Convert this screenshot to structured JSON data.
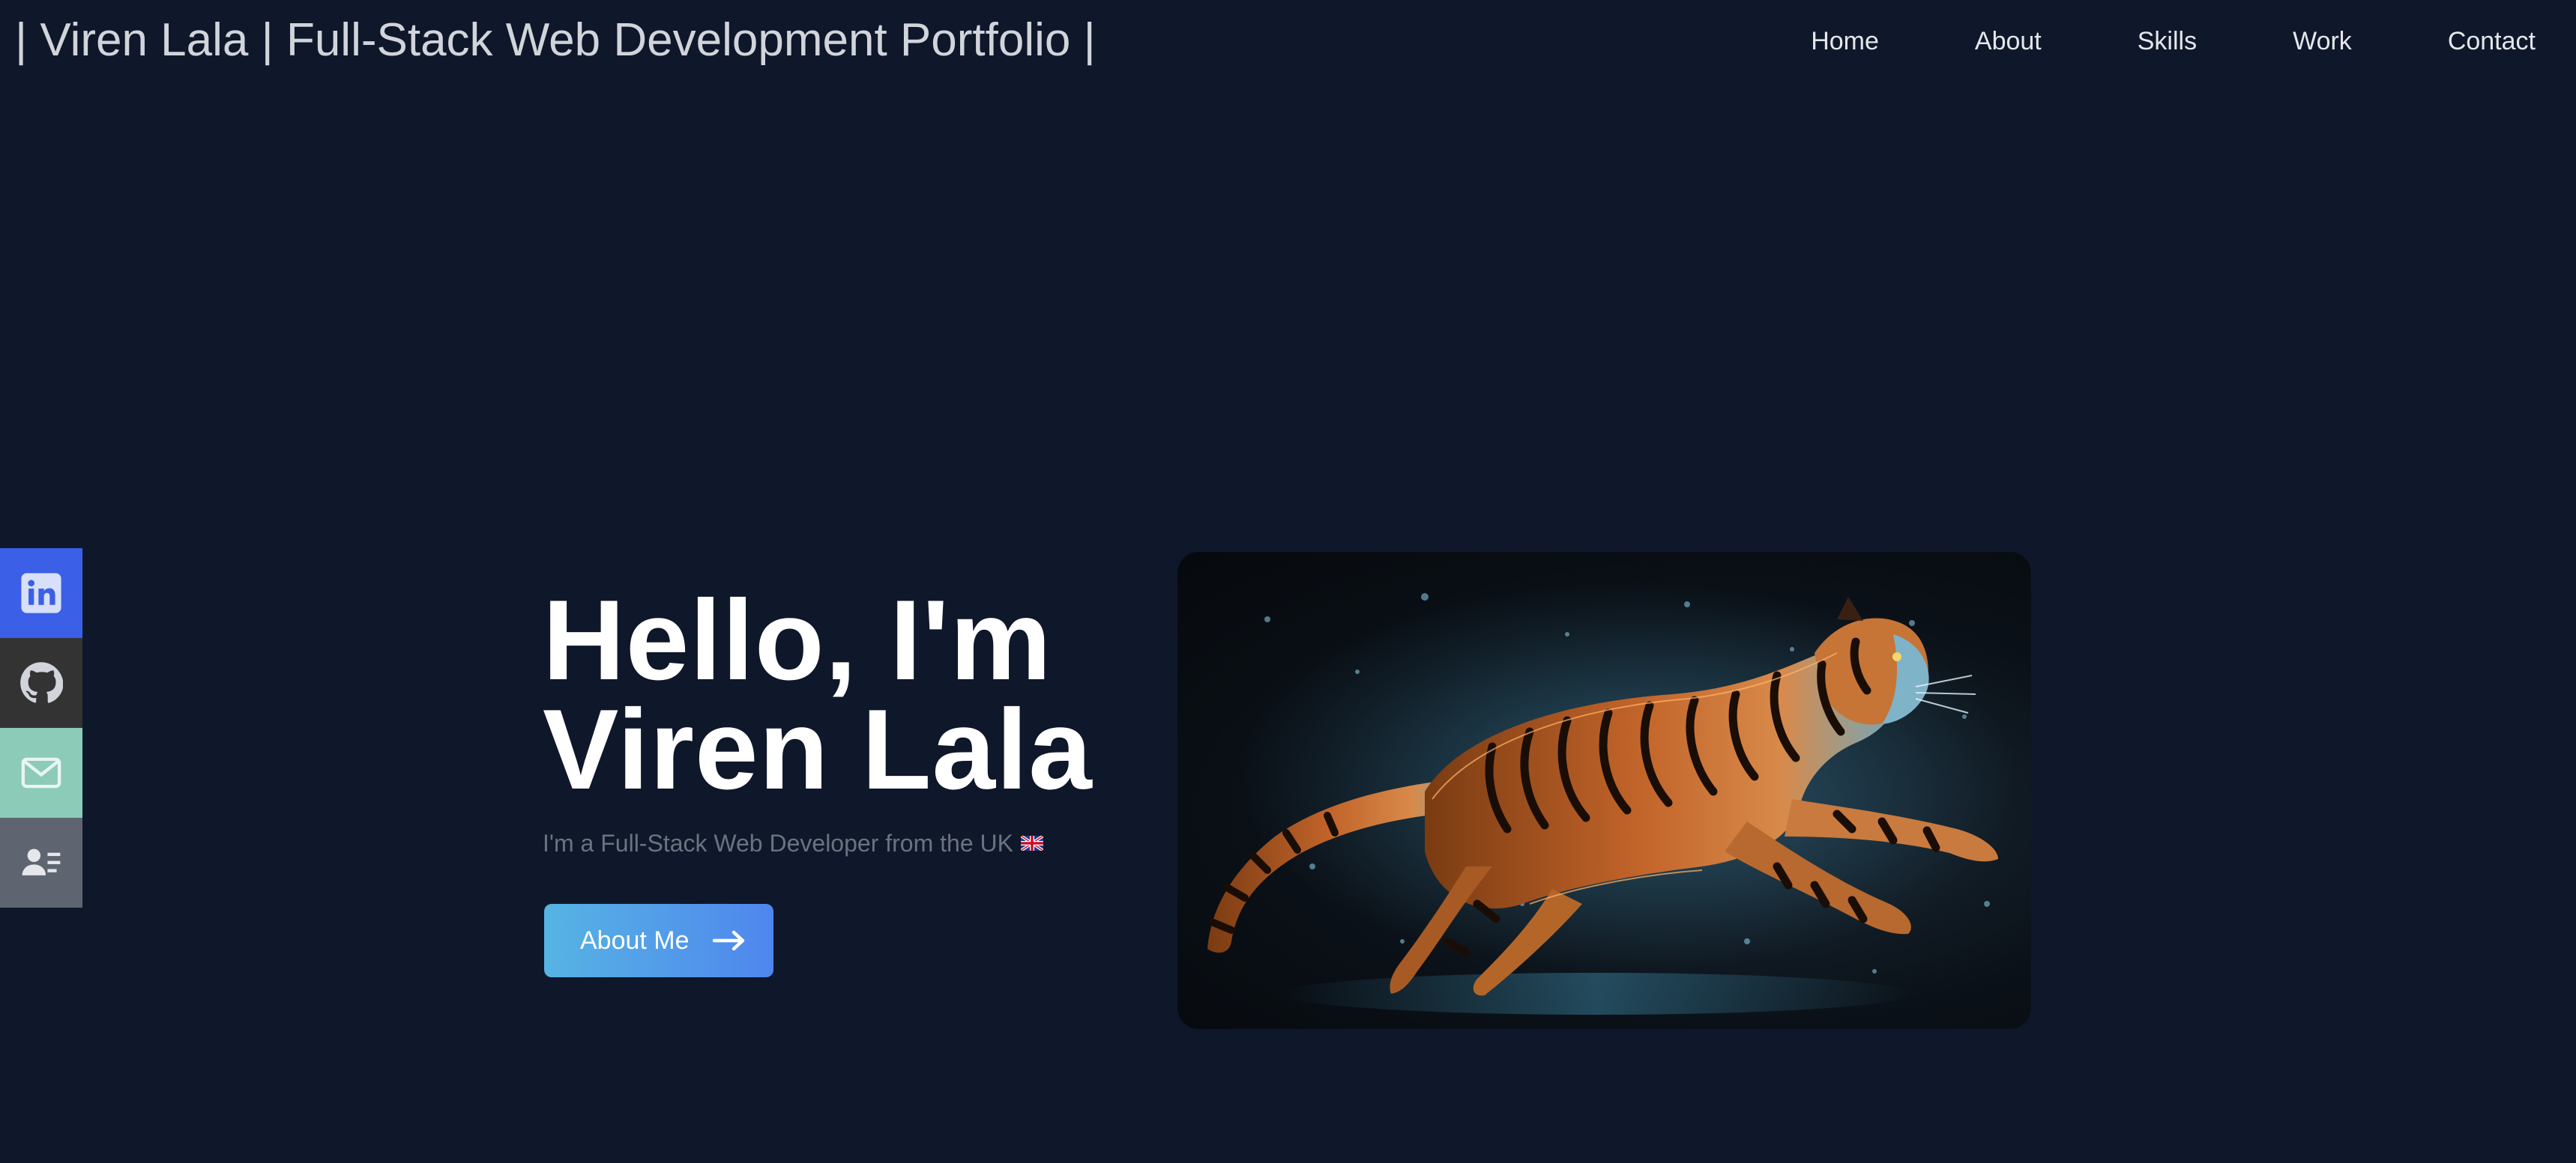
{
  "header": {
    "site_title": "| Viren Lala | Full-Stack Web Development Portfolio |",
    "nav": [
      "Home",
      "About",
      "Skills",
      "Work",
      "Contact"
    ]
  },
  "social": {
    "items": [
      {
        "name": "linkedin-icon",
        "color": "#3b5fe6"
      },
      {
        "name": "github-icon",
        "color": "#333333"
      },
      {
        "name": "email-icon",
        "color": "#8ccbb7"
      },
      {
        "name": "resume-icon",
        "color": "#5f6570"
      }
    ]
  },
  "hero": {
    "title_line1": "Hello, I'm",
    "title_line2": "Viren Lala",
    "subtitle": "I'm a Full-Stack Web Developer from the UK",
    "button_label": "About Me",
    "image_alt": "tiger-image"
  },
  "colors": {
    "background": "#0f172a",
    "button_gradient_start": "#56b4e3",
    "button_gradient_end": "#4f86ee"
  }
}
